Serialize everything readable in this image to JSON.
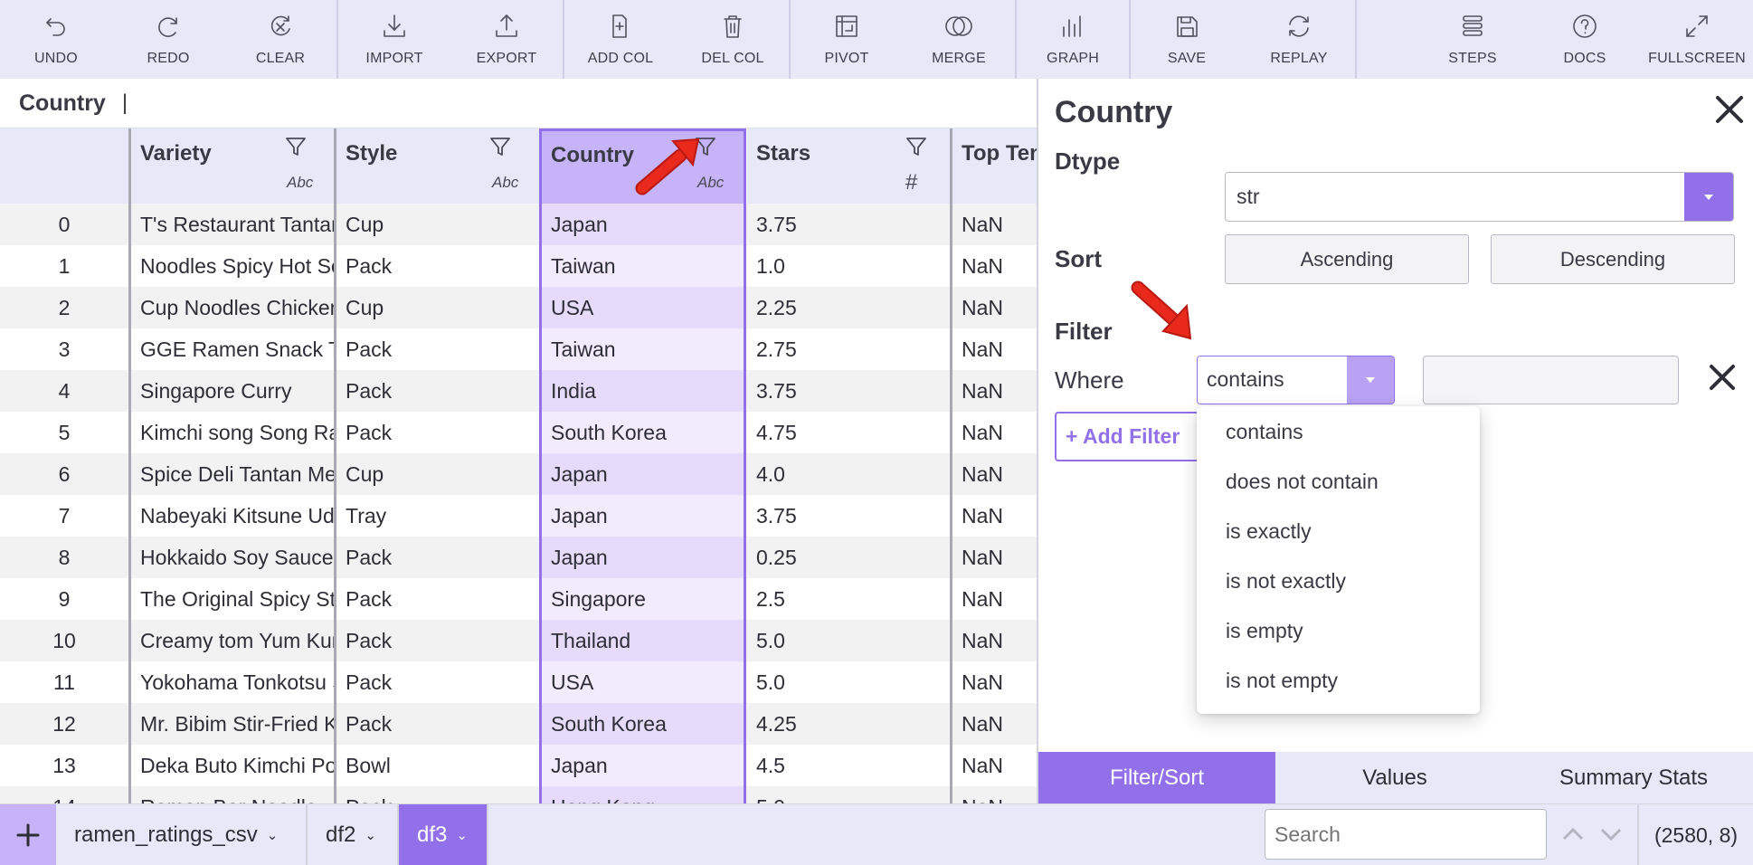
{
  "toolbar": {
    "groups": [
      [
        {
          "key": "undo",
          "label": "UNDO"
        },
        {
          "key": "redo",
          "label": "REDO"
        },
        {
          "key": "clear",
          "label": "CLEAR"
        }
      ],
      [
        {
          "key": "import",
          "label": "IMPORT"
        },
        {
          "key": "export",
          "label": "EXPORT"
        }
      ],
      [
        {
          "key": "add-col",
          "label": "ADD COL"
        },
        {
          "key": "del-col",
          "label": "DEL COL"
        }
      ],
      [
        {
          "key": "pivot",
          "label": "PIVOT"
        },
        {
          "key": "merge",
          "label": "MERGE"
        }
      ],
      [
        {
          "key": "graph",
          "label": "GRAPH"
        }
      ],
      [
        {
          "key": "save",
          "label": "SAVE"
        },
        {
          "key": "replay",
          "label": "REPLAY"
        }
      ]
    ],
    "right_group": [
      {
        "key": "steps",
        "label": "STEPS"
      },
      {
        "key": "docs",
        "label": "DOCS"
      },
      {
        "key": "fullscreen",
        "label": "FULLSCREEN"
      }
    ]
  },
  "formula_bar": {
    "column": "Country",
    "cursor": "|"
  },
  "grid": {
    "columns": [
      {
        "name": "Variety",
        "type_tag": "Abc",
        "icon": "filter-icon"
      },
      {
        "name": "Style",
        "type_tag": "Abc",
        "icon": "filter-icon"
      },
      {
        "name": "Country",
        "type_tag": "Abc",
        "icon": "filter-icon",
        "selected": true
      },
      {
        "name": "Stars",
        "type_tag": "#",
        "icon": "filter-icon"
      },
      {
        "name": "Top Ten"
      }
    ],
    "rows": [
      [
        "0",
        "T's Restaurant Tantan",
        "Cup",
        "Japan",
        "3.75",
        "NaN"
      ],
      [
        "1",
        "Noodles Spicy Hot Sesame",
        "Pack",
        "Taiwan",
        "1.0",
        "NaN"
      ],
      [
        "2",
        "Cup Noodles Chicken",
        "Cup",
        "USA",
        "2.25",
        "NaN"
      ],
      [
        "3",
        "GGE Ramen Snack Tomato",
        "Pack",
        "Taiwan",
        "2.75",
        "NaN"
      ],
      [
        "4",
        "Singapore Curry",
        "Pack",
        "India",
        "3.75",
        "NaN"
      ],
      [
        "5",
        "Kimchi song Song Ramen",
        "Pack",
        "South Korea",
        "4.75",
        "NaN"
      ],
      [
        "6",
        "Spice Deli Tantan Men",
        "Cup",
        "Japan",
        "4.0",
        "NaN"
      ],
      [
        "7",
        "Nabeyaki Kitsune Udon",
        "Tray",
        "Japan",
        "3.75",
        "NaN"
      ],
      [
        "8",
        "Hokkaido Soy Sauce",
        "Pack",
        "Japan",
        "0.25",
        "NaN"
      ],
      [
        "9",
        "The Original Spicy Stir",
        "Pack",
        "Singapore",
        "2.5",
        "NaN"
      ],
      [
        "10",
        "Creamy tom Yum Kung",
        "Pack",
        "Thailand",
        "5.0",
        "NaN"
      ],
      [
        "11",
        "Yokohama Tonkotsu Shoyu",
        "Pack",
        "USA",
        "5.0",
        "NaN"
      ],
      [
        "12",
        "Mr. Bibim Stir-Fried Kimchi",
        "Pack",
        "South Korea",
        "4.25",
        "NaN"
      ],
      [
        "13",
        "Deka Buto Kimchi Pork",
        "Bowl",
        "Japan",
        "4.5",
        "NaN"
      ],
      [
        "14",
        "Ramen Bar Noodle",
        "Pack",
        "Hong Kong",
        "5.0",
        "NaN"
      ]
    ]
  },
  "panel": {
    "title": "Country",
    "dtype_label": "Dtype",
    "dtype_value": "str",
    "sort_label": "Sort",
    "sort_ascending": "Ascending",
    "sort_descending": "Descending",
    "filter_label": "Filter",
    "where_label": "Where",
    "where_value": "contains",
    "filter_value": "",
    "add_filter": "+ Add Filter",
    "dropdown_options": [
      "contains",
      "does not contain",
      "is exactly",
      "is not exactly",
      "is empty",
      "is not empty"
    ],
    "tabs": [
      {
        "label": "Filter/Sort",
        "active": true
      },
      {
        "label": "Values"
      },
      {
        "label": "Summary Stats"
      }
    ]
  },
  "footer": {
    "sheets": [
      {
        "label": "ramen_ratings_csv"
      },
      {
        "label": "df2"
      },
      {
        "label": "df3",
        "active": true
      }
    ],
    "search_placeholder": "Search",
    "shape": "(2580, 8)"
  },
  "colors": {
    "accent": "#9270ea",
    "accent_light": "#c7b3f7",
    "toolbar_bg": "#e8e9f8",
    "arrow": "#e8291c"
  }
}
